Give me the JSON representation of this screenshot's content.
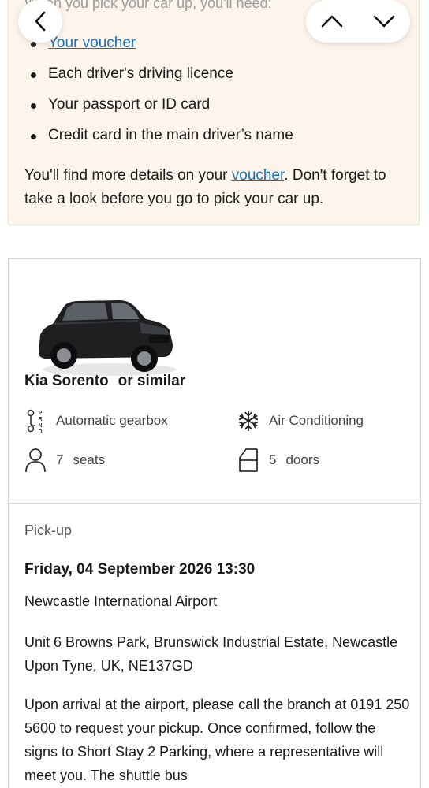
{
  "info": {
    "intro": "When you pick your car up, you'll need:",
    "requirements": [
      {
        "text": "Your voucher",
        "is_link": true
      },
      {
        "text": "Each driver's driving licence",
        "is_link": false
      },
      {
        "text": "Your passport or ID card",
        "is_link": false
      },
      {
        "text": "Credit card in the main driver’s name",
        "is_link": false
      }
    ],
    "details_before": "You'll find more details on your ",
    "details_link": "voucher",
    "details_after": ". Don't forget to take a look before you go to pick your car up."
  },
  "nav": {
    "back_icon": "chevron-left-icon",
    "up_icon": "chevron-up-icon",
    "down_icon": "chevron-down-icon"
  },
  "car": {
    "name": "Kia Sorento",
    "similar": "or similar",
    "gearbox": "Automatic gearbox",
    "ac": "Air Conditioning",
    "seats_count": "7",
    "seats_label": "seats",
    "doors_count": "5",
    "doors_label": "doors",
    "gear_icon_letters": [
      "P",
      "R",
      "N",
      "D"
    ]
  },
  "pickup": {
    "label": "Pick-up",
    "datetime": "Friday, 04 September 2026 13:30",
    "location": "Newcastle International Airport",
    "address": "Unit 6 Browns Park, Brunswick Industrial Estate, Newcastle Upon Tyne, UK, NE137GD",
    "instructions": "Upon arrival at the airport, please call the branch at 0191 250 5600 to request your pickup. Once confirmed, follow the signs to Short Stay 2 Parking, where a representative will meet you. The shuttle bus"
  },
  "colors": {
    "panel_bg": "#fdf5ec",
    "link": "#1a6fb5",
    "text": "#1a1a1a",
    "muted": "#555555"
  }
}
